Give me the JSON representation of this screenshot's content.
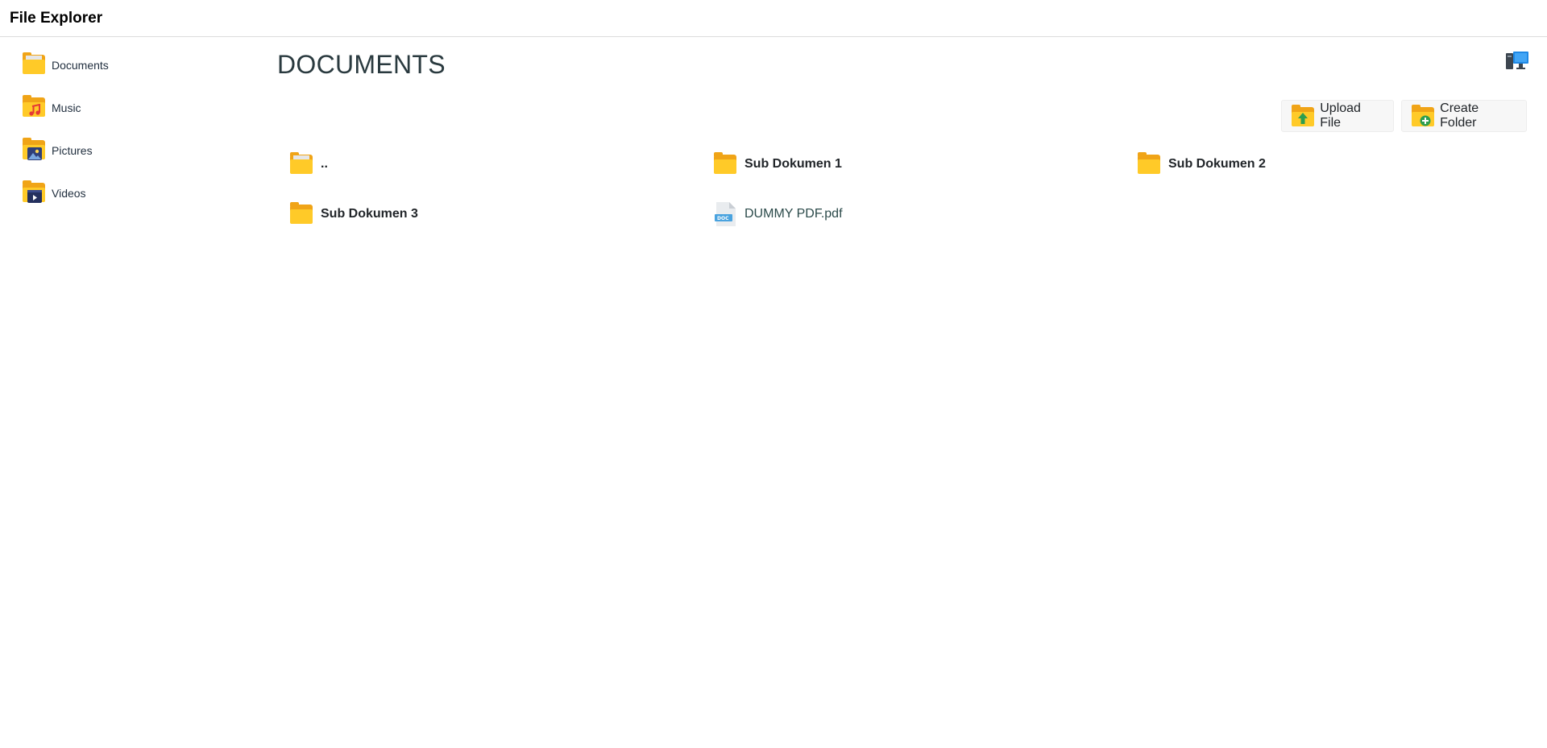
{
  "app": {
    "title": "File Explorer"
  },
  "sidebar": {
    "items": [
      {
        "label": "Documents",
        "icon": "documents-folder-icon"
      },
      {
        "label": "Music",
        "icon": "music-folder-icon"
      },
      {
        "label": "Pictures",
        "icon": "pictures-folder-icon"
      },
      {
        "label": "Videos",
        "icon": "videos-folder-icon"
      }
    ]
  },
  "main": {
    "title": "DOCUMENTS",
    "toolbar": {
      "upload_label": "Upload File",
      "create_label": "Create Folder"
    },
    "entries": [
      {
        "label": "..",
        "type": "parent"
      },
      {
        "label": "Sub Dokumen 1",
        "type": "folder"
      },
      {
        "label": "Sub Dokumen 2",
        "type": "folder"
      },
      {
        "label": "Sub Dokumen 3",
        "type": "folder"
      },
      {
        "label": "DUMMY PDF.pdf",
        "type": "file",
        "badge": "DOC"
      }
    ]
  },
  "colors": {
    "folder_front": "#ffca28",
    "folder_back": "#f0a417",
    "upload_arrow": "#2e9e4f",
    "create_plus": "#2e9e4f",
    "doc_badge": "#4aa3df"
  }
}
